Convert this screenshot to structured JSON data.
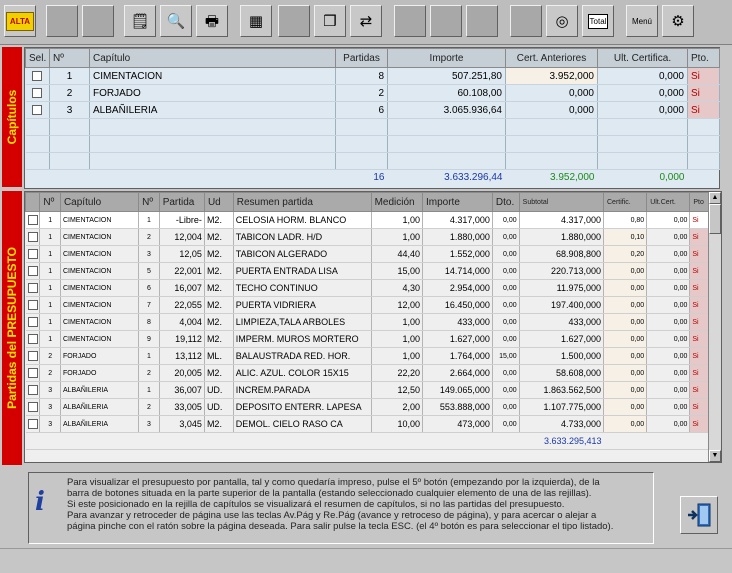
{
  "toolbar": {
    "alta_label": "ALTA",
    "total_label": "Total",
    "menu_label": "Menú"
  },
  "side_labels": {
    "capitulos": "Capítulos",
    "presupuesto": "Partidas del PRESUPUESTO"
  },
  "capitulos": {
    "headers": [
      "Sel.",
      "Nº",
      "Capítulo",
      "Partidas",
      "Importe",
      "Cert. Anteriores",
      "Ult. Certifica.",
      "Pto."
    ],
    "rows": [
      {
        "n": "1",
        "capitulo": "CIMENTACION",
        "partidas": "8",
        "importe": "507.251,80",
        "cert_ant": "3.952,000",
        "ult_cert": "0,000",
        "pto": "Si"
      },
      {
        "n": "2",
        "capitulo": "FORJADO",
        "partidas": "2",
        "importe": "60.108,00",
        "cert_ant": "0,000",
        "ult_cert": "0,000",
        "pto": "Si"
      },
      {
        "n": "3",
        "capitulo": "ALBAÑILERIA",
        "partidas": "6",
        "importe": "3.065.936,64",
        "cert_ant": "0,000",
        "ult_cert": "0,000",
        "pto": "Si"
      }
    ],
    "totals": {
      "partidas": "16",
      "importe": "3.633.296,44",
      "cert_ant": "3.952,000",
      "ult_cert": "0,000"
    }
  },
  "presupuesto": {
    "headers": [
      "Nº",
      "Capítulo",
      "Nº",
      "Partida",
      "Ud",
      "Resumen partida",
      "Medición",
      "Importe",
      "Dto.",
      "Subtotal",
      "Certific.",
      "Ult.Cert.",
      "Pto"
    ],
    "rows": [
      {
        "cn": "1",
        "capitulo": "CIMENTACION",
        "n": "1",
        "partida": "-Libre-",
        "ud": "M2.",
        "resumen": "CELOSIA HORM. BLANCO",
        "medicion": "1,00",
        "importe": "4.317,000",
        "dto": "0,00",
        "subtotal": "4.317,000",
        "certific": "0,80",
        "ult": "0,00",
        "pto": "Si"
      },
      {
        "cn": "1",
        "capitulo": "CIMENTACION",
        "n": "2",
        "partida": "12,004",
        "ud": "M2.",
        "resumen": "TABICON LADR. H/D",
        "medicion": "1,00",
        "importe": "1.880,000",
        "dto": "0,00",
        "subtotal": "1.880,000",
        "certific": "0,10",
        "ult": "0,00",
        "pto": "Si"
      },
      {
        "cn": "1",
        "capitulo": "CIMENTACION",
        "n": "3",
        "partida": "12,05",
        "ud": "M2.",
        "resumen": "TABICON ALGERADO",
        "medicion": "44,40",
        "importe": "1.552,000",
        "dto": "0,00",
        "subtotal": "68.908,800",
        "certific": "0,20",
        "ult": "0,00",
        "pto": "Si"
      },
      {
        "cn": "1",
        "capitulo": "CIMENTACION",
        "n": "5",
        "partida": "22,001",
        "ud": "M2.",
        "resumen": "PUERTA ENTRADA LISA",
        "medicion": "15,00",
        "importe": "14.714,000",
        "dto": "0,00",
        "subtotal": "220.713,000",
        "certific": "0,00",
        "ult": "0,00",
        "pto": "Si"
      },
      {
        "cn": "1",
        "capitulo": "CIMENTACION",
        "n": "6",
        "partida": "16,007",
        "ud": "M2.",
        "resumen": "TECHO CONTINUO",
        "medicion": "4,30",
        "importe": "2.954,000",
        "dto": "0,00",
        "subtotal": "11.975,000",
        "certific": "0,00",
        "ult": "0,00",
        "pto": "Si"
      },
      {
        "cn": "1",
        "capitulo": "CIMENTACION",
        "n": "7",
        "partida": "22,055",
        "ud": "M2.",
        "resumen": "PUERTA VIDRIERA",
        "medicion": "12,00",
        "importe": "16.450,000",
        "dto": "0,00",
        "subtotal": "197.400,000",
        "certific": "0,00",
        "ult": "0,00",
        "pto": "Si"
      },
      {
        "cn": "1",
        "capitulo": "CIMENTACION",
        "n": "8",
        "partida": "4,004",
        "ud": "M2.",
        "resumen": "LIMPIEZA,TALA ARBOLES",
        "medicion": "1,00",
        "importe": "433,000",
        "dto": "0,00",
        "subtotal": "433,000",
        "certific": "0,00",
        "ult": "0,00",
        "pto": "Si"
      },
      {
        "cn": "1",
        "capitulo": "CIMENTACION",
        "n": "9",
        "partida": "19,112",
        "ud": "M2.",
        "resumen": "IMPERM. MUROS MORTERO",
        "medicion": "1,00",
        "importe": "1.627,000",
        "dto": "0,00",
        "subtotal": "1.627,000",
        "certific": "0,00",
        "ult": "0,00",
        "pto": "Si"
      },
      {
        "cn": "2",
        "capitulo": "FORJADO",
        "n": "1",
        "partida": "13,112",
        "ud": "ML.",
        "resumen": "BALAUSTRADA RED. HOR.",
        "medicion": "1,00",
        "importe": "1.764,000",
        "dto": "15,00",
        "subtotal": "1.500,000",
        "certific": "0,00",
        "ult": "0,00",
        "pto": "Si"
      },
      {
        "cn": "2",
        "capitulo": "FORJADO",
        "n": "2",
        "partida": "20,005",
        "ud": "M2.",
        "resumen": "ALIC. AZUL. COLOR 15X15",
        "medicion": "22,20",
        "importe": "2.664,000",
        "dto": "0,00",
        "subtotal": "58.608,000",
        "certific": "0,00",
        "ult": "0,00",
        "pto": "Si"
      },
      {
        "cn": "3",
        "capitulo": "ALBAÑILERIA",
        "n": "1",
        "partida": "36,007",
        "ud": "UD.",
        "resumen": "INCREM.PARADA",
        "medicion": "12,50",
        "importe": "149.065,000",
        "dto": "0,00",
        "subtotal": "1.863.562,500",
        "certific": "0,00",
        "ult": "0,00",
        "pto": "Si"
      },
      {
        "cn": "3",
        "capitulo": "ALBAÑILERIA",
        "n": "2",
        "partida": "33,005",
        "ud": "UD.",
        "resumen": "DEPOSITO ENTERR. LAPESA",
        "medicion": "2,00",
        "importe": "553.888,000",
        "dto": "0,00",
        "subtotal": "1.107.775,000",
        "certific": "0,00",
        "ult": "0,00",
        "pto": "Si"
      },
      {
        "cn": "3",
        "capitulo": "ALBAÑILERIA",
        "n": "3",
        "partida": "3,045",
        "ud": "M2.",
        "resumen": "DEMOL. CIELO RASO CA",
        "medicion": "10,00",
        "importe": "473,000",
        "dto": "0,00",
        "subtotal": "4.733,000",
        "certific": "0,00",
        "ult": "0,00",
        "pto": "Si"
      }
    ],
    "total": "3.633.295,413"
  },
  "info": {
    "lines": [
      "Para visualizar el presupuesto por pantalla, tal y como quedaría impreso, pulse el 5º botón (empezando por la izquierda), de la",
      "barra de botones situada en la parte superior de la pantalla (estando seleccionado cualquier elemento de una de las rejillas).",
      "Si este posicionado en la rejilla de capítulos se visualizará el resumen de capítulos, si no las partidas del presupuesto.",
      "Para avanzar y retroceder de página use las teclas Av.Pág y Re.Pág (avance y retroceso de página), y para acercar o alejar a",
      "página pinche con el ratón sobre la página deseada. Para salir pulse la tecla ESC. (el 4º botón es para seleccionar el tipo listado)."
    ]
  }
}
